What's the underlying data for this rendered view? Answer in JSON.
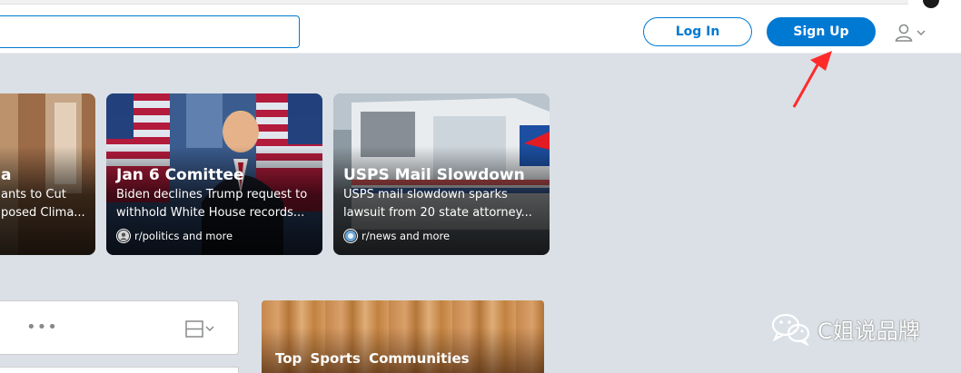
{
  "header": {
    "search": {
      "placeholder": ""
    },
    "login_label": "Log In",
    "signup_label": "Sign Up",
    "user_menu_icon": "user-icon",
    "chevron_icon": "chevron-down-icon"
  },
  "trending": [
    {
      "title": "a",
      "desc_line1": "ants to Cut",
      "desc_line2": "posed Clima...",
      "subreddit": ""
    },
    {
      "title": "Jan 6 Comittee",
      "desc_line1": "Biden declines Trump request to",
      "desc_line2": "withhold White House records...",
      "subreddit": "r/politics and more"
    },
    {
      "title": "USPS Mail Slowdown",
      "desc_line1": "USPS mail slowdown sparks",
      "desc_line2": "lawsuit from 20 state attorney...",
      "subreddit": "r/news and more"
    }
  ],
  "feed": {
    "more_icon": "more-options-icon",
    "layout_icon": "card-layout-icon"
  },
  "sidebar": {
    "sports_title": "Top  Sports  Communities"
  },
  "watermark": {
    "text": "C姐说品牌"
  },
  "colors": {
    "accent": "#0079d3",
    "background": "#dae0e6",
    "annotation": "#ff2b2b"
  }
}
